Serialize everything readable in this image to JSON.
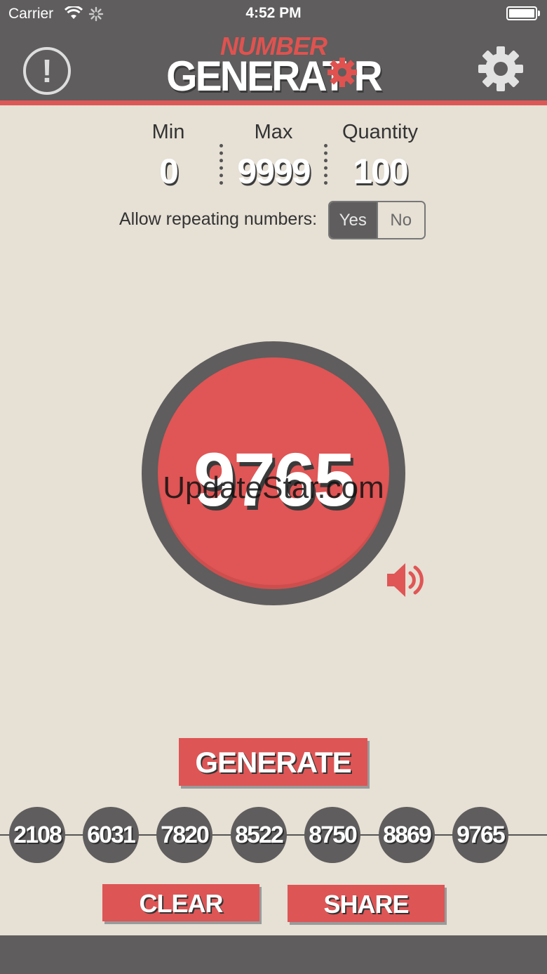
{
  "status_bar": {
    "carrier": "Carrier",
    "time": "4:52 PM"
  },
  "header": {
    "logo_top": "NUMBER",
    "logo_bottom": "GENERAT R",
    "info_icon": "exclamation-circle-icon",
    "settings_icon": "gear-icon"
  },
  "settings": {
    "min": {
      "label": "Min",
      "value": "0"
    },
    "max": {
      "label": "Max",
      "value": "9999"
    },
    "quantity": {
      "label": "Quantity",
      "value": "100"
    },
    "repeat_label": "Allow repeating numbers:",
    "repeat_options": [
      "Yes",
      "No"
    ],
    "repeat_selected": "Yes"
  },
  "result": {
    "number": "9765",
    "watermark": "UpdateStar.com",
    "sound_icon": "speaker-icon"
  },
  "actions": {
    "generate": "GENERATE",
    "clear": "CLEAR",
    "share": "SHARE"
  },
  "history": [
    "2108",
    "6031",
    "7820",
    "8522",
    "8750",
    "8869",
    "9765"
  ],
  "colors": {
    "accent": "#dd5757",
    "dark": "#5f5d5d",
    "background": "#e6e0d5"
  }
}
